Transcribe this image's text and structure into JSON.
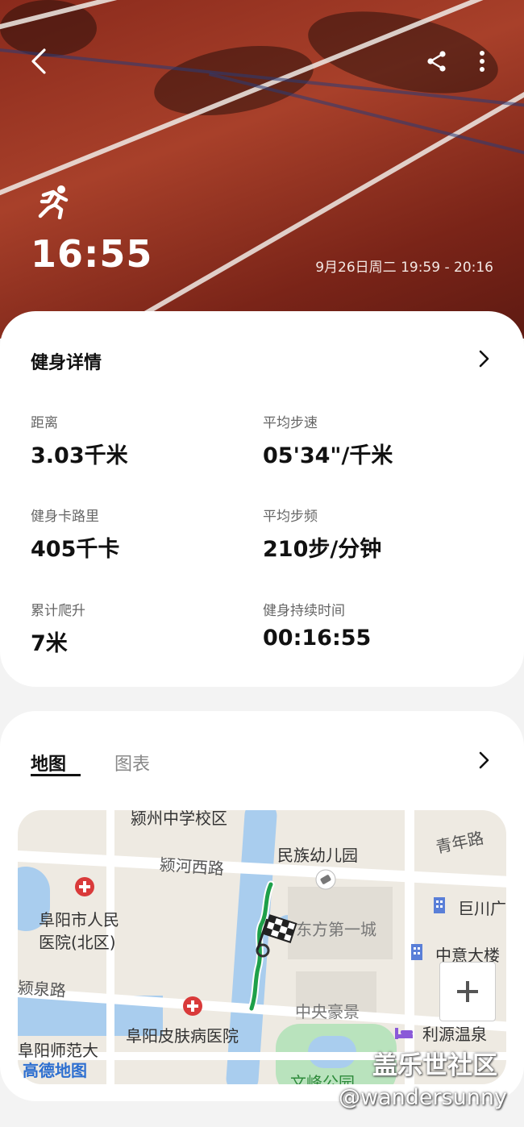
{
  "header": {
    "duration": "16:55",
    "datetime": "9月26日周二 19:59 - 20:16",
    "icons": [
      "back-arrow-icon",
      "share-icon",
      "more-icon",
      "running-icon"
    ]
  },
  "details": {
    "title": "健身详情",
    "stats": [
      {
        "label": "距离",
        "value": "3.03千米"
      },
      {
        "label": "平均步速",
        "value": "05'34\"/千米"
      },
      {
        "label": "健身卡路里",
        "value": "405千卡"
      },
      {
        "label": "平均步频",
        "value": "210步/分钟"
      },
      {
        "label": "累计爬升",
        "value": "7米"
      },
      {
        "label": "健身持续时间",
        "value": "00:16:55"
      }
    ]
  },
  "map_section": {
    "tabs": [
      {
        "label": "地图",
        "active": true
      },
      {
        "label": "图表",
        "active": false
      }
    ],
    "labels": {
      "school": "颍州中学校区",
      "road1": "颍河西路",
      "kindergarten": "民族幼儿园",
      "road2": "青年路",
      "hospital1a": "阜阳市人民",
      "hospital1b": "医院(北区)",
      "estate1": "东方第一城",
      "building1": "巨川广",
      "building2": "中意大楼",
      "road3": "颍泉路",
      "estate2": "中央豪景",
      "hospital2": "阜阳皮肤病医院",
      "hotel": "利源温泉",
      "university": "阜阳师范大",
      "park": "文峰公园",
      "logo": "高德地图"
    }
  },
  "watermark": "盖乐世社区",
  "credit": "@wandersunny",
  "colors": {
    "accent": "#1ea049",
    "hero": "#a8402a"
  }
}
